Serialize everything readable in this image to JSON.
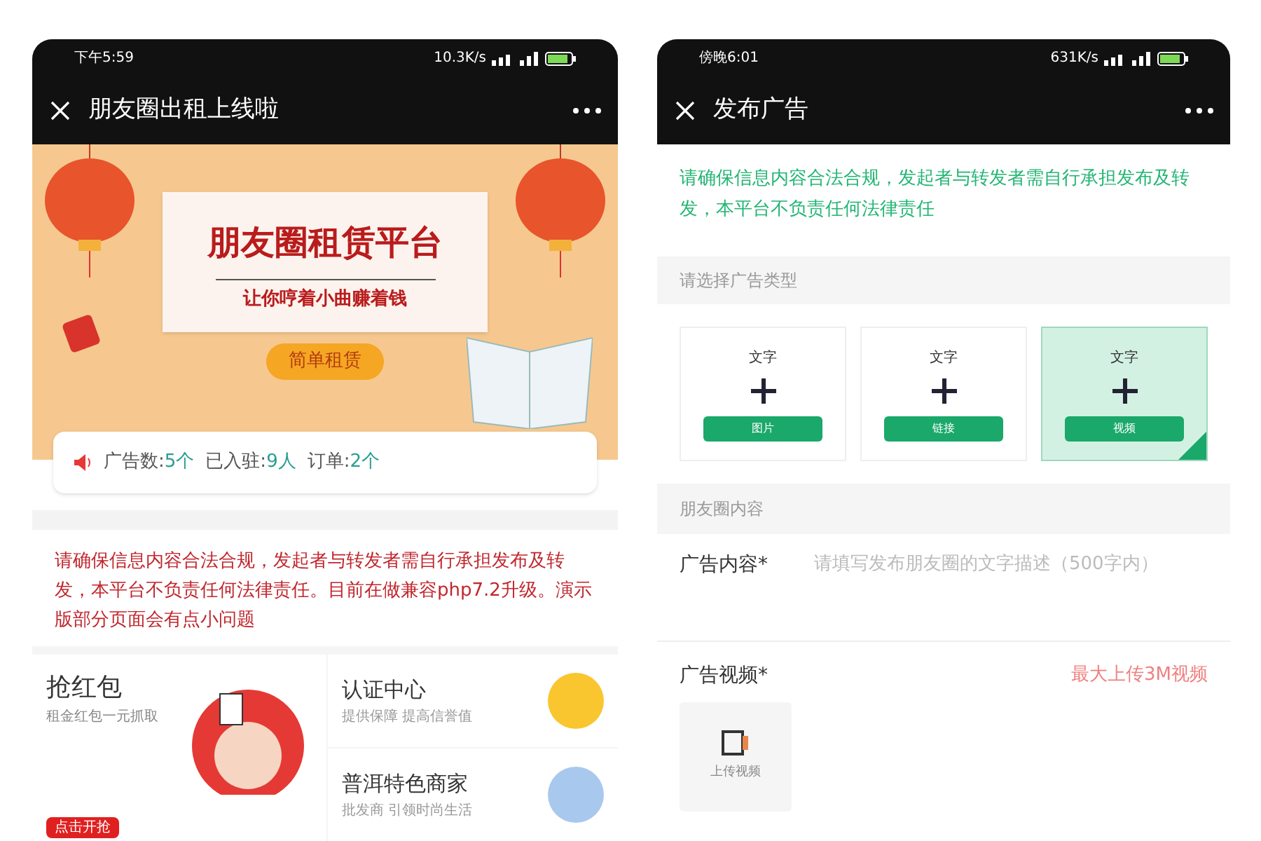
{
  "phones": [
    {
      "status_bar": {
        "time": "下午5:59",
        "speed": "10.3K/s"
      },
      "title": "朋友圈出租上线啦",
      "banner": {
        "headline": "朋友圈租赁平台",
        "slogan": "让你哼着小曲赚着钱",
        "badge": "简单租赁"
      },
      "stats": [
        {
          "label": "广告数:",
          "value": "5个"
        },
        {
          "label": "已入驻:",
          "value": "9人"
        },
        {
          "label": "订单:",
          "value": "2个"
        }
      ],
      "notice": "请确保信息内容合法合规，发起者与转发者需自行承担发布及转发，本平台不负责任何法律责任。目前在做兼容php7.2升级。演示版部分页面会有点小问题",
      "promo": {
        "title": "抢红包",
        "subtitle": "租金红包一元抓取",
        "button": "点击开抢"
      },
      "features": [
        {
          "title": "认证中心",
          "subtitle": "提供保障 提高信誉值",
          "color": "#f9c630"
        },
        {
          "title": "普洱特色商家",
          "subtitle": "批发商 引领时尚生活",
          "color": "#a9c8ee"
        }
      ]
    },
    {
      "status_bar": {
        "time": "傍晚6:01",
        "speed": "631K/s"
      },
      "title": "发布广告",
      "notice": "请确保信息内容合法合规，发起者与转发者需自行承担发布及转发，本平台不负责任何法律责任",
      "type_section": "请选择广告类型",
      "ad_types": [
        {
          "label": "文字",
          "button": "图片",
          "selected": false
        },
        {
          "label": "文字",
          "button": "链接",
          "selected": false
        },
        {
          "label": "文字",
          "button": "视频",
          "selected": true
        }
      ],
      "content_section": "朋友圈内容",
      "content_field": {
        "label": "广告内容*",
        "placeholder": "请填写发布朋友圈的文字描述（500字内）"
      },
      "video_field": {
        "label": "广告视频*",
        "hint": "最大上传3M视频",
        "upload": "上传视频"
      }
    }
  ]
}
